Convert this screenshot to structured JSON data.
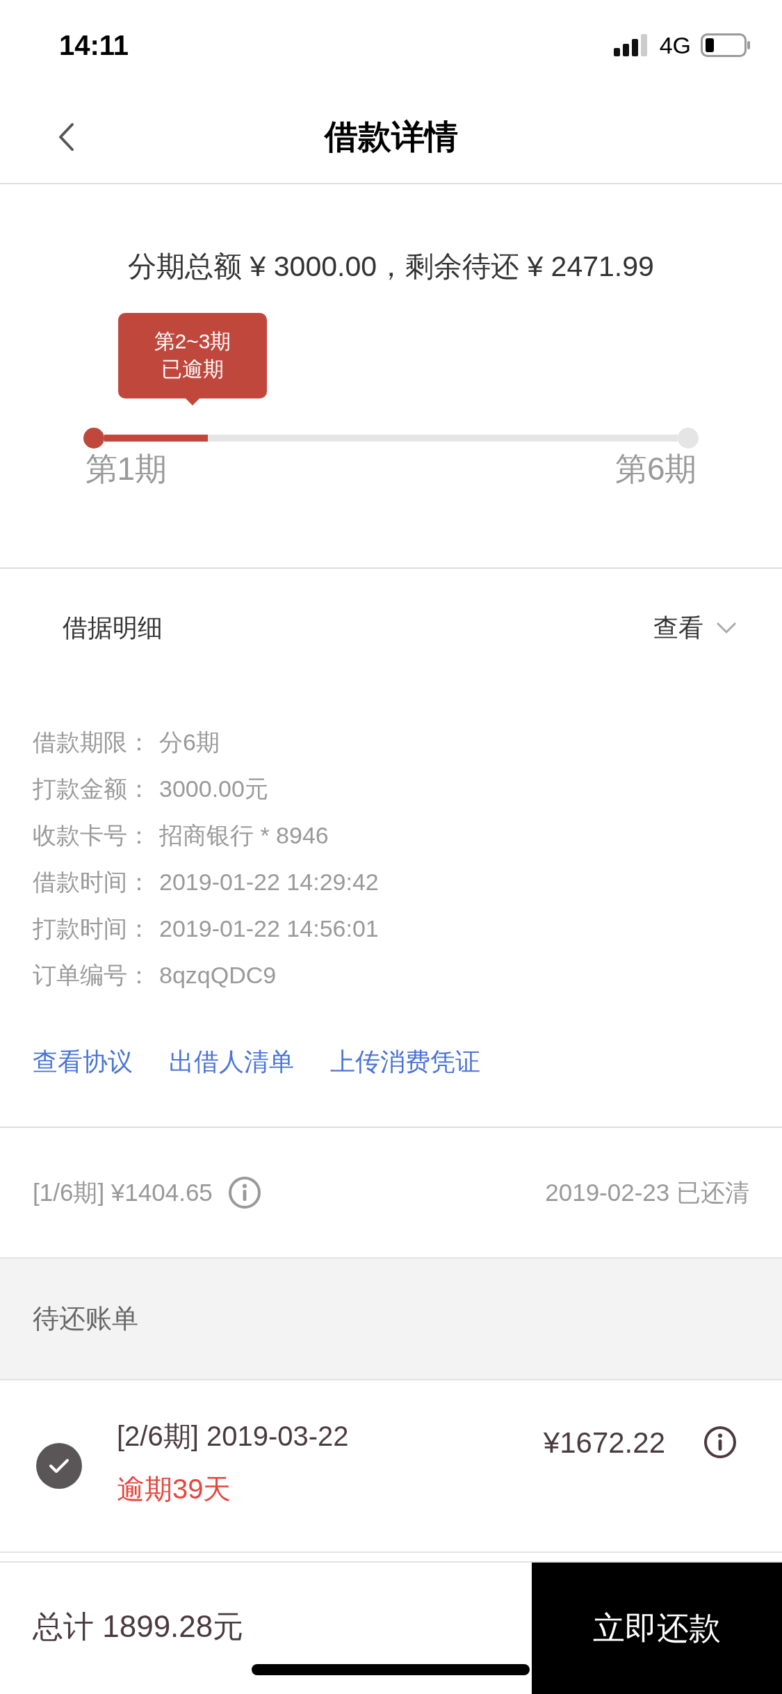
{
  "status_bar": {
    "time": "14:11",
    "network": "4G"
  },
  "nav": {
    "title": "借款详情"
  },
  "summary": {
    "text": "分期总额 ¥ 3000.00，剩余待还 ¥ 2471.99",
    "tooltip": [
      "第2~3期",
      "已逾期"
    ],
    "level": 0.18,
    "start_label": "第1期",
    "end_label": "第6期"
  },
  "details": {
    "title": "借据明细",
    "toggle": "查看",
    "expanded": true,
    "rows": [
      {
        "label": "借款期限：",
        "value": "分6期"
      },
      {
        "label": "打款金额：",
        "value": "3000.00元"
      },
      {
        "label": "收款卡号：",
        "value": "招商银行 * 8946"
      },
      {
        "label": "借款时间：",
        "value": "2019-01-22 14:29:42"
      },
      {
        "label": "打款时间：",
        "value": "2019-01-22 14:56:01"
      },
      {
        "label": "订单编号：",
        "value": "8qzqQDC9"
      }
    ],
    "links": [
      "查看协议",
      "出借人清单",
      "上传消费凭证"
    ]
  },
  "paid": {
    "text": "[1/6期] ¥1404.65",
    "status": "2019-02-23 已还清"
  },
  "pending": {
    "title": "待还账单",
    "bills": [
      {
        "period": "[2/6期] 2019-03-22",
        "overdue": "逾期39天",
        "amount": "¥1672.22",
        "checked": true
      }
    ]
  },
  "footer": {
    "total": "总计 1899.28元",
    "button": "立即还款"
  }
}
